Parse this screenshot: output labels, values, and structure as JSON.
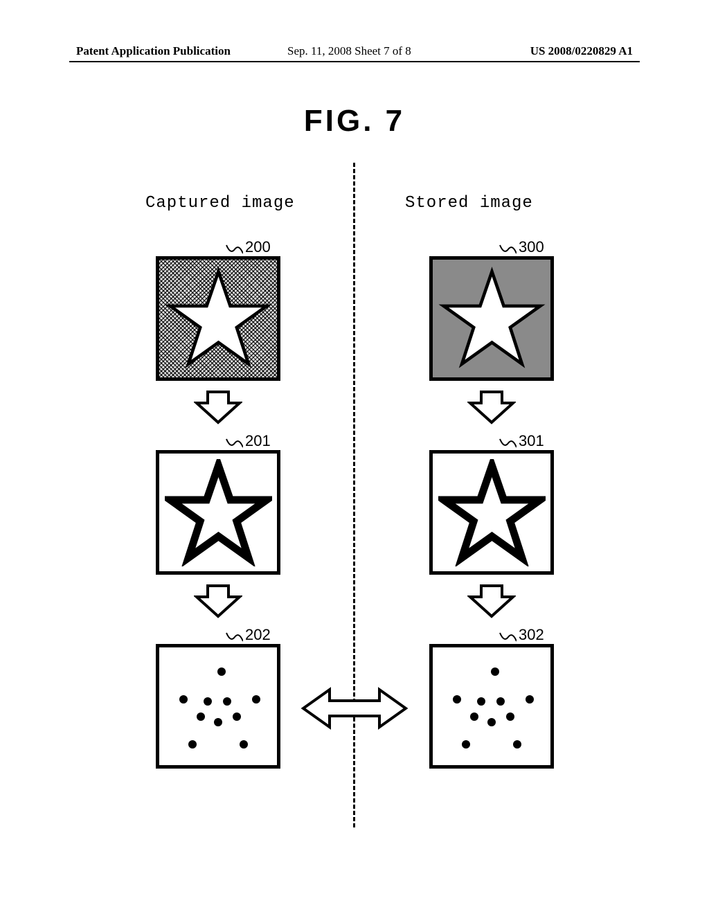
{
  "header": {
    "left": "Patent Application Publication",
    "middle": "Sep. 11, 2008  Sheet 7 of 8",
    "right": "US 2008/0220829 A1"
  },
  "figure_title": "FIG. 7",
  "columns": {
    "left_label": "Captured image",
    "right_label": "Stored image"
  },
  "refs": {
    "r200": "200",
    "r201": "201",
    "r202": "202",
    "r300": "300",
    "r301": "301",
    "r302": "302"
  }
}
